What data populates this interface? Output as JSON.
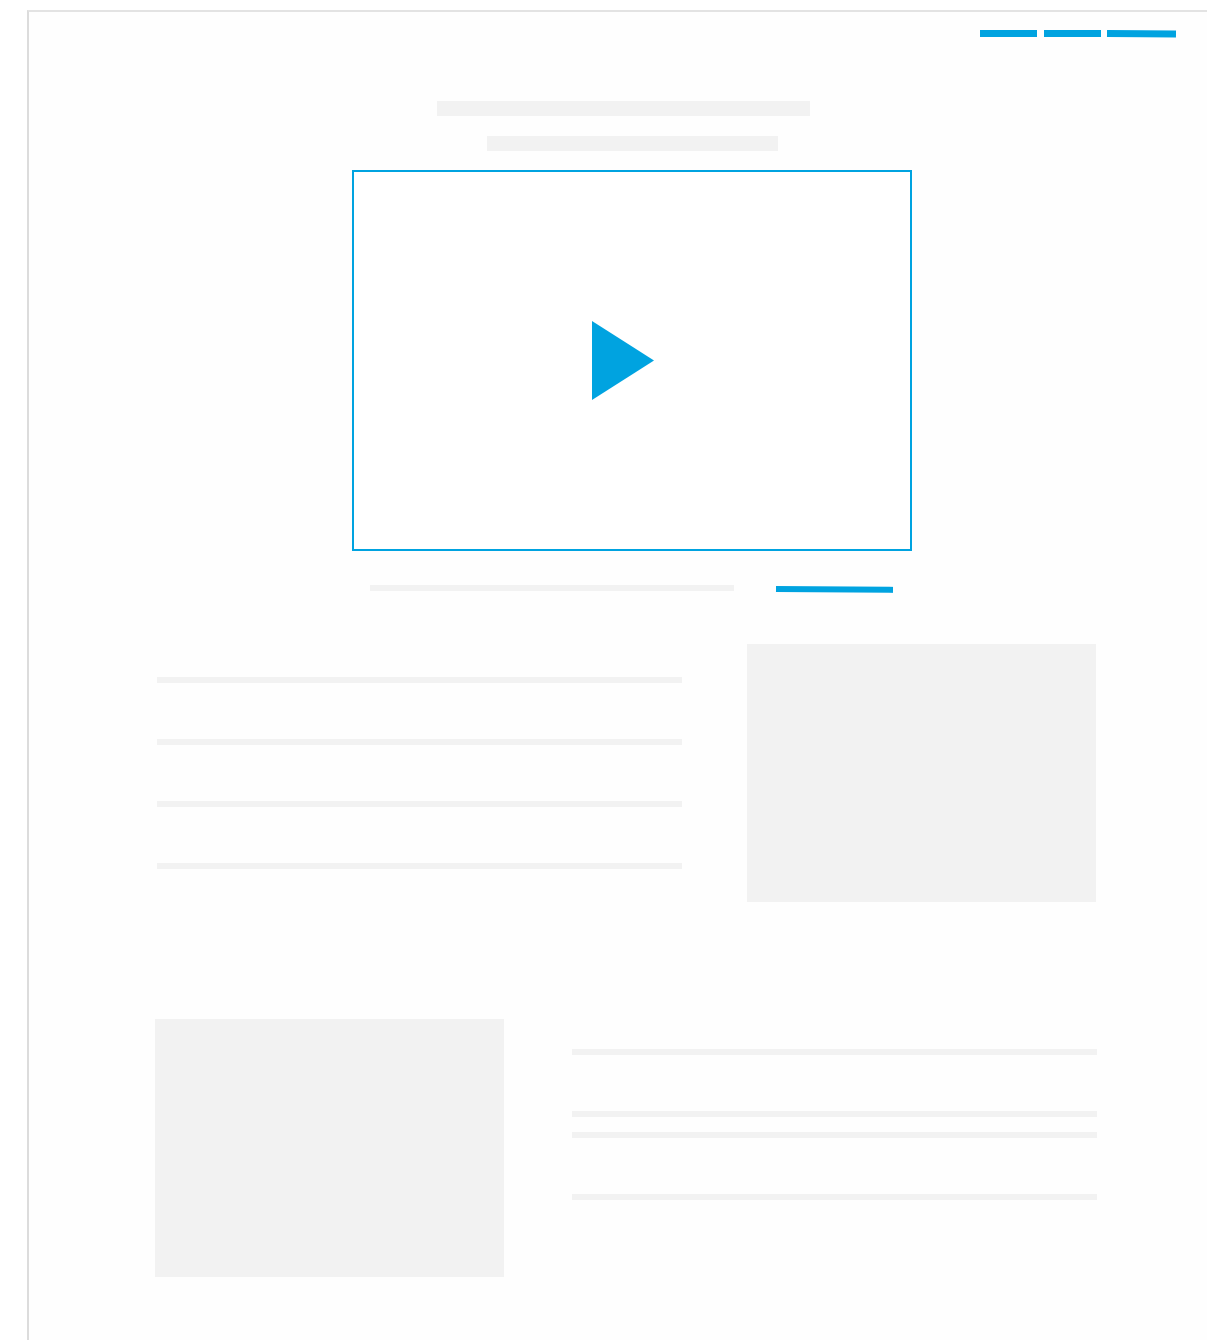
{
  "colors": {
    "accent": "#00a3e0",
    "placeholder": "#f2f2f2",
    "frame_border": "#dcdcdc",
    "background": "#ffffff"
  },
  "nav": {
    "items": [
      {
        "name": "nav-item-1"
      },
      {
        "name": "nav-item-2"
      },
      {
        "name": "nav-item-3"
      }
    ]
  },
  "hero": {
    "video": {
      "icon": "play-icon"
    }
  }
}
